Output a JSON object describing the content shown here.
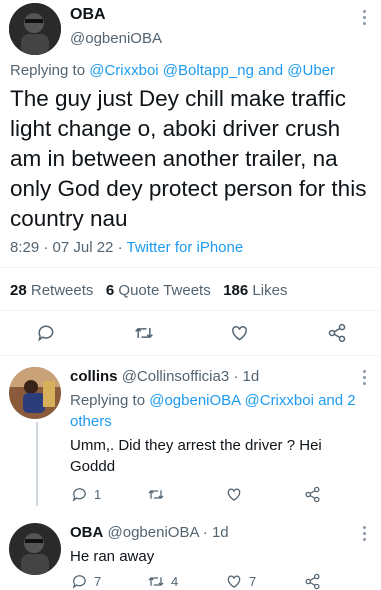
{
  "main_tweet": {
    "name": "OBA",
    "handle": "@ogbeniOBA",
    "replying_prefix": "Replying to",
    "replying_mentions": "@Crixxboi @Boltapp_ng",
    "replying_and": "and",
    "replying_last": "@Uber",
    "text": "The guy just Dey chill make traffic light change o, aboki driver crush am in between another trailer, na only God dey protect person for this country nau",
    "time": "8:29 · 07 Jul 22 ·",
    "source": "Twitter for iPhone"
  },
  "stats": {
    "retweets_count": "28",
    "retweets_label": "Retweets",
    "quotes_count": "6",
    "quotes_label": "Quote Tweets",
    "likes_count": "186",
    "likes_label": "Likes"
  },
  "replies": [
    {
      "name": "collins",
      "handle": "@Collinsofficia3 · 1d",
      "replying_prefix": "Replying to",
      "replying_mentions": "@ogbeniOBA @Crixxboi",
      "replying_and": "and",
      "replying_others": "2 others",
      "text": "Umm,. Did they arrest the driver ? Hei Goddd",
      "reply_count": "1",
      "retweet_count": "",
      "like_count": ""
    },
    {
      "name": "OBA",
      "handle": "@ogbeniOBA · 1d",
      "text": "He ran away",
      "reply_count": "7",
      "retweet_count": "4",
      "like_count": "7"
    }
  ],
  "colors": {
    "accent": "#1d9bf0",
    "muted": "#536471",
    "divider": "#eff3f4"
  },
  "icons": [
    "more-icon",
    "reply-icon",
    "retweet-icon",
    "like-icon",
    "share-icon"
  ]
}
